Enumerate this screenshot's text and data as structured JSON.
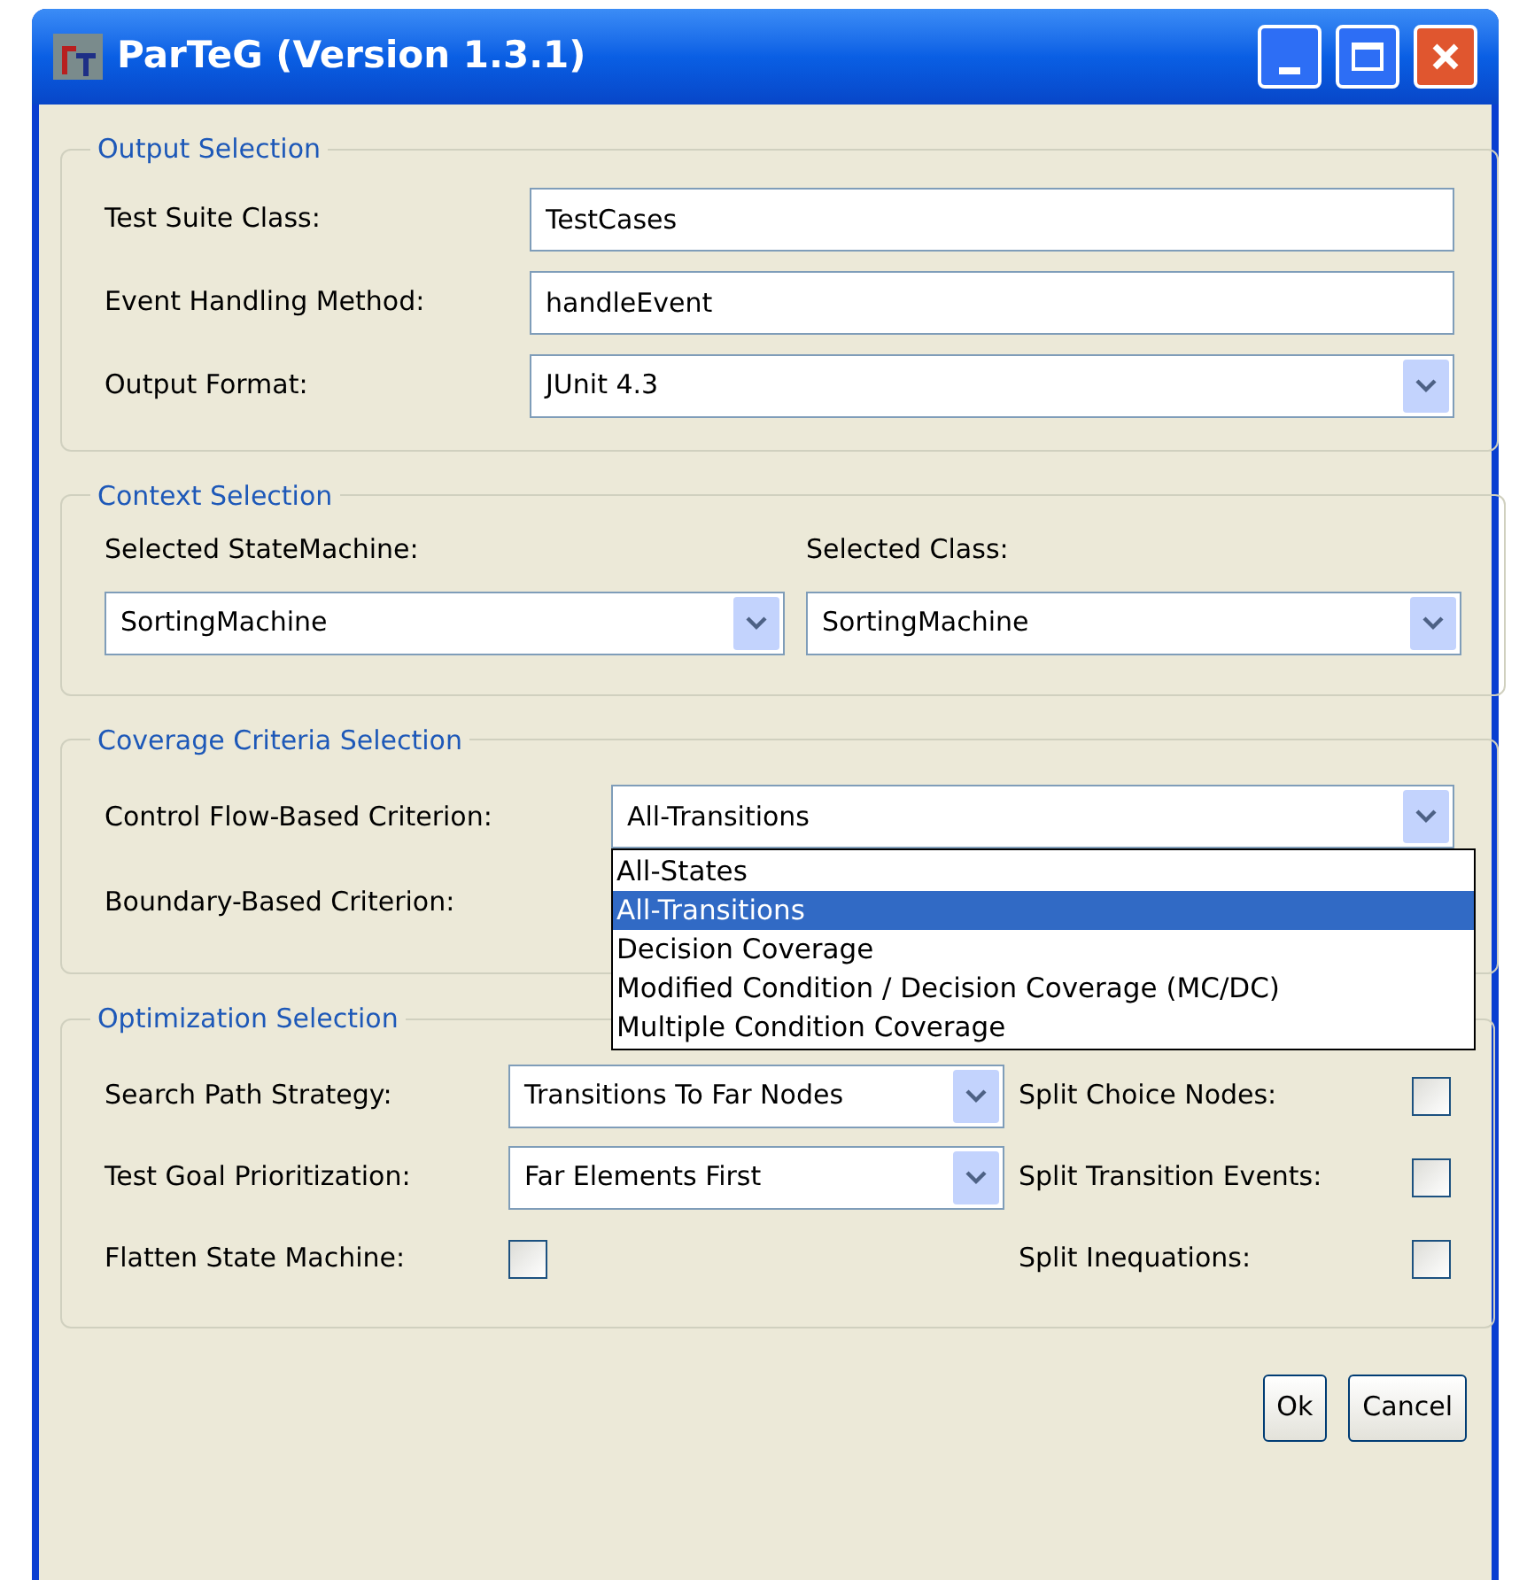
{
  "window": {
    "title": "ParTeG (Version 1.3.1)"
  },
  "output_selection": {
    "title": "Output Selection",
    "fields": [
      {
        "kind": "text",
        "label": "Test Suite Class:",
        "value": "TestCases"
      },
      {
        "kind": "text",
        "label": "Event Handling Method:",
        "value": "handleEvent"
      },
      {
        "kind": "combo",
        "label": "Output Format:",
        "value": "JUnit 4.3"
      }
    ]
  },
  "context_selection": {
    "title": "Context Selection",
    "fields": [
      {
        "label": "Selected StateMachine:",
        "value": "SortingMachine"
      },
      {
        "label": "Selected Class:",
        "value": "SortingMachine"
      }
    ]
  },
  "coverage_selection": {
    "title": "Coverage Criteria Selection",
    "control_flow": {
      "label": "Control Flow-Based Criterion:",
      "value": "All-Transitions"
    },
    "boundary": {
      "label": "Boundary-Based Criterion:"
    },
    "open_list": [
      {
        "label": "All-States",
        "selected": false
      },
      {
        "label": "All-Transitions",
        "selected": true
      },
      {
        "label": "Decision Coverage",
        "selected": false
      },
      {
        "label": "Modified Condition / Decision Coverage (MC/DC)",
        "selected": false
      },
      {
        "label": "Multiple Condition Coverage",
        "selected": false
      }
    ]
  },
  "optimization_selection": {
    "title": "Optimization Selection",
    "left": [
      {
        "kind": "combo",
        "label": "Search Path Strategy:",
        "value": "Transitions To Far Nodes"
      },
      {
        "kind": "combo",
        "label": "Test Goal Prioritization:",
        "value": "Far Elements First"
      },
      {
        "kind": "checkbox",
        "label": "Flatten State Machine:",
        "checked": false
      }
    ],
    "right": [
      {
        "label": "Split Choice Nodes:",
        "checked": false
      },
      {
        "label": "Split Transition Events:",
        "checked": false
      },
      {
        "label": "Split Inequations:",
        "checked": false
      }
    ]
  },
  "buttons": [
    "Ok",
    "Cancel"
  ]
}
